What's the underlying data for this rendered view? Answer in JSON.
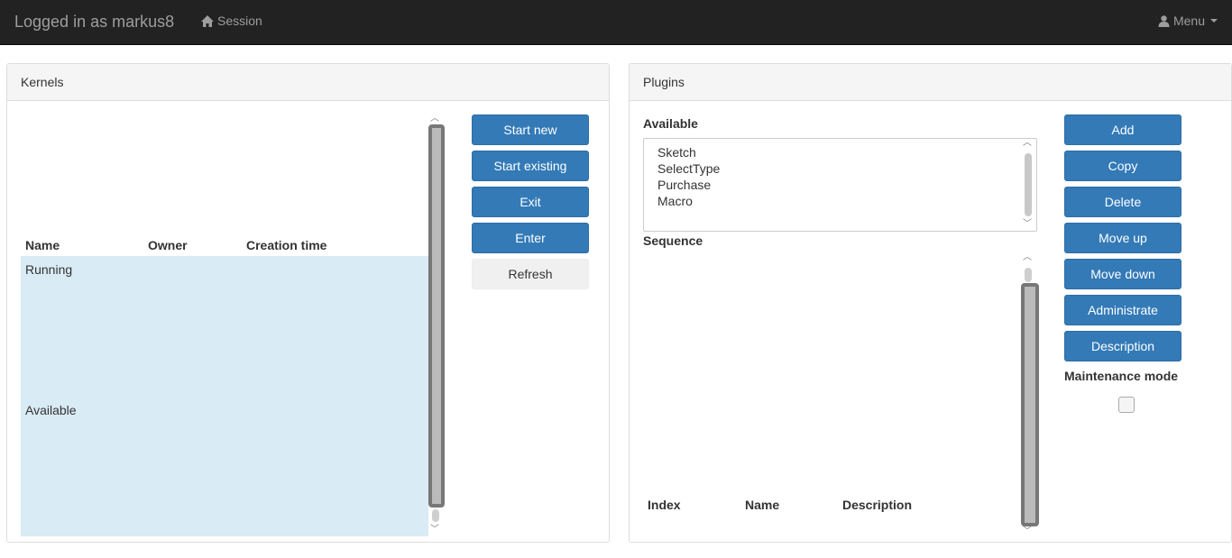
{
  "navbar": {
    "brand": "Logged in as markus8",
    "session_label": "Session",
    "menu_label": "Menu"
  },
  "kernels": {
    "title": "Kernels",
    "columns": [
      "Name",
      "Owner",
      "Creation time"
    ],
    "groups": [
      "Running",
      "Available"
    ],
    "buttons": {
      "start_new": "Start new",
      "start_existing": "Start existing",
      "exit": "Exit",
      "enter": "Enter",
      "refresh": "Refresh"
    }
  },
  "plugins": {
    "title": "Plugins",
    "available_label": "Available",
    "available_items": [
      "Sketch",
      "SelectType",
      "Purchase",
      "Macro"
    ],
    "sequence_label": "Sequence",
    "sequence_columns": [
      "Index",
      "Name",
      "Description"
    ],
    "buttons": {
      "add": "Add",
      "copy": "Copy",
      "delete": "Delete",
      "move_up": "Move up",
      "move_down": "Move down",
      "administrate": "Administrate",
      "description": "Description"
    },
    "maintenance_label": "Maintenance mode"
  }
}
